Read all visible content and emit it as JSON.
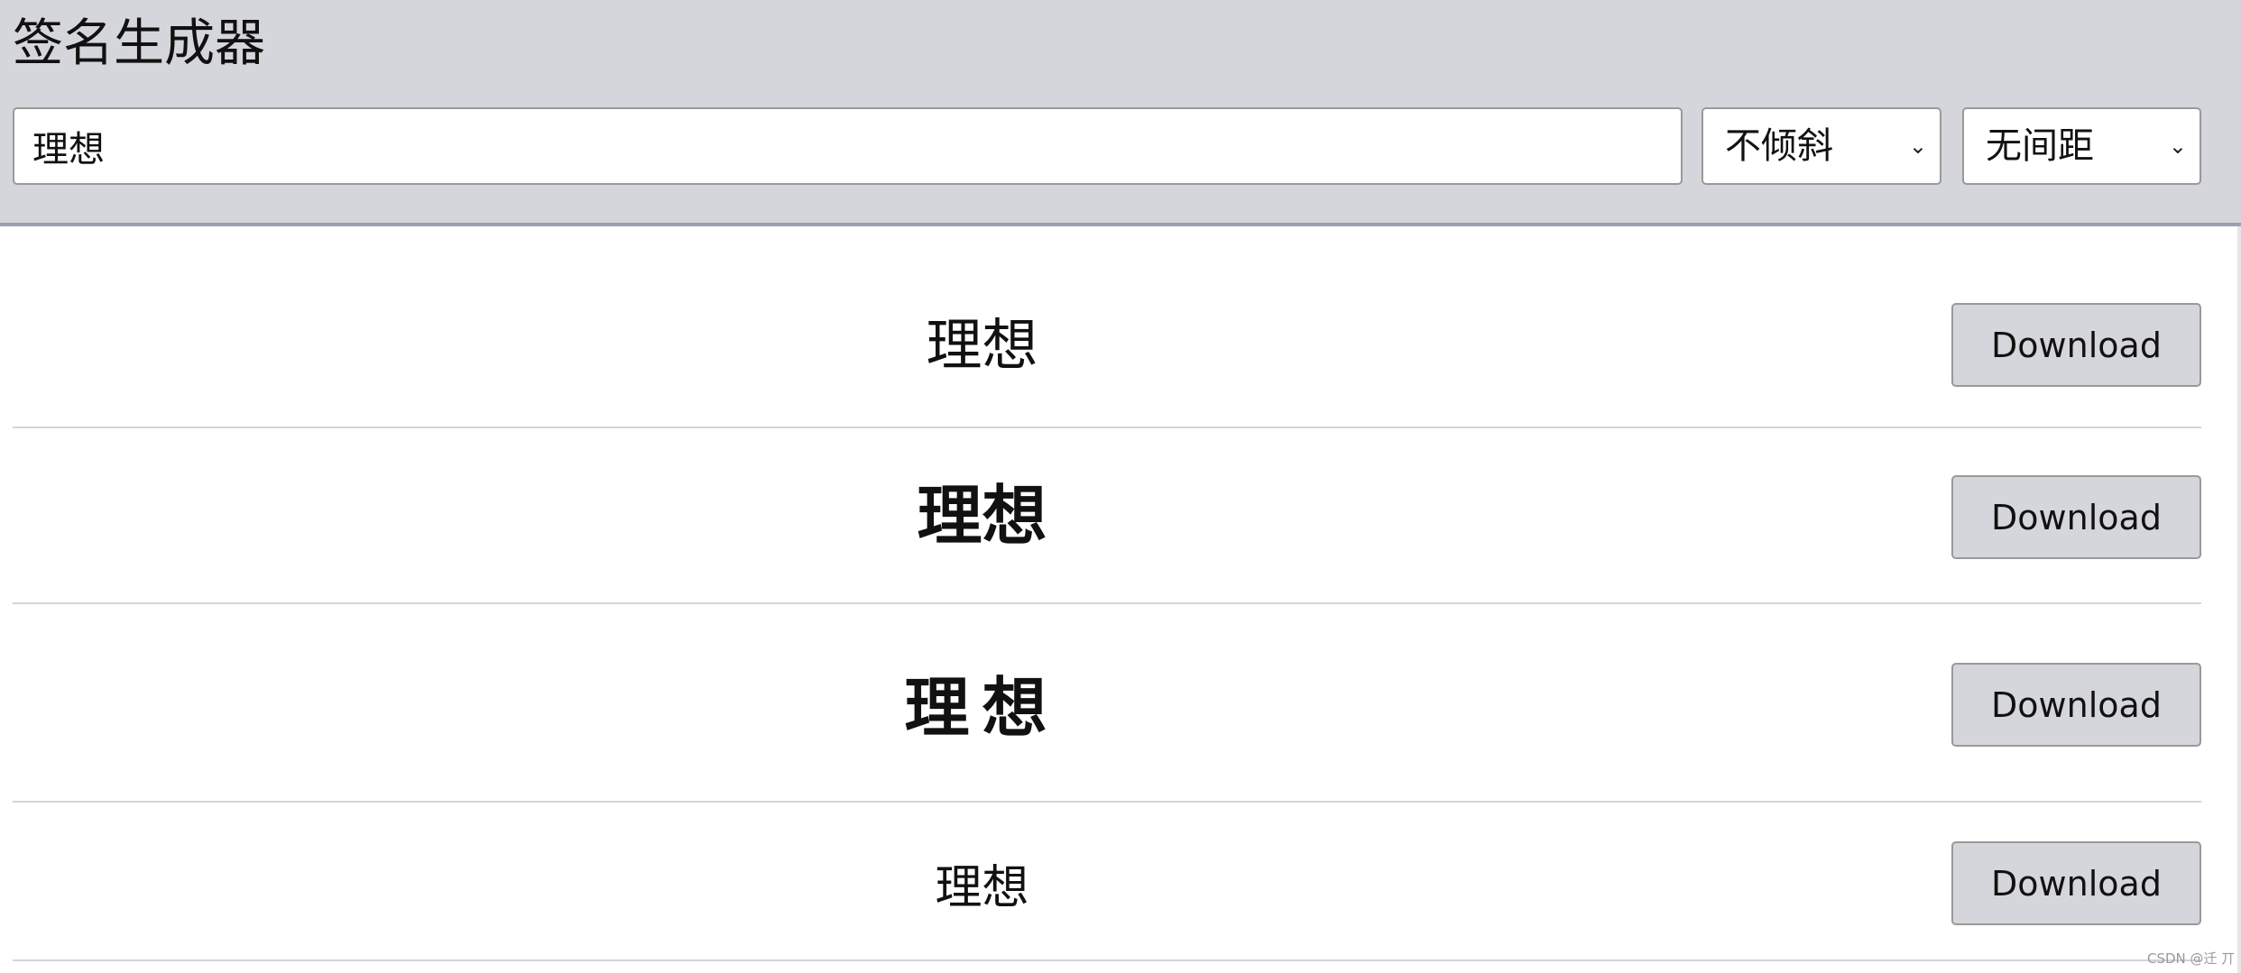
{
  "header": {
    "title": "签名生成器",
    "input_value": "理想",
    "slant_select": "不倾斜",
    "spacing_select": "无间距"
  },
  "rows": [
    {
      "text": "理想",
      "button": "Download"
    },
    {
      "text": "理想",
      "button": "Download"
    },
    {
      "text": "理想",
      "button": "Download"
    },
    {
      "text": "理想",
      "button": "Download"
    }
  ],
  "watermark": "CSDN @迁 丌",
  "colors": {
    "header_bg": "#d5d6db",
    "button_bg": "#d5d6db",
    "header_border": "#9aa0b0"
  }
}
